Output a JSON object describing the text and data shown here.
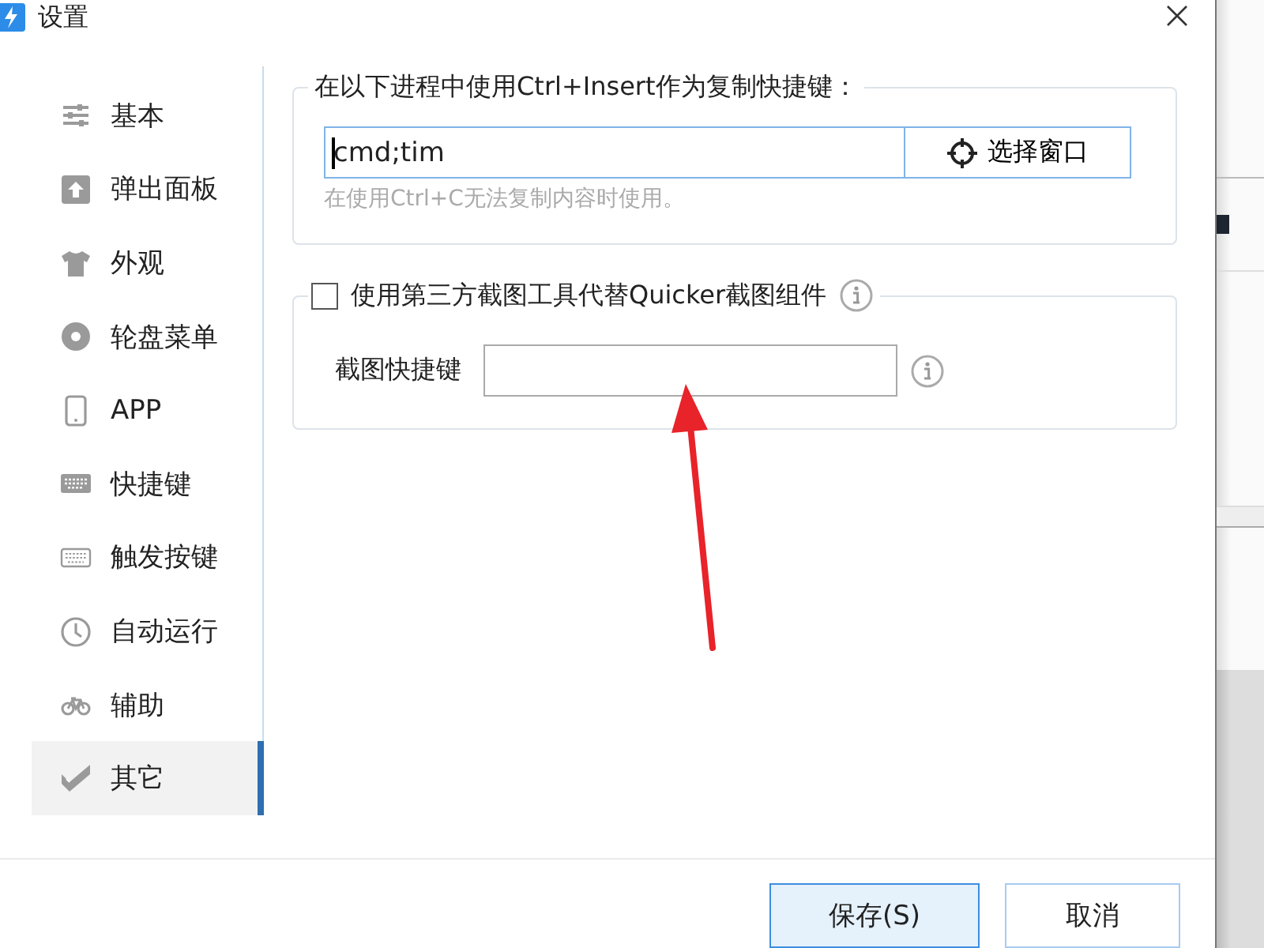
{
  "window": {
    "title": "设置"
  },
  "sidebar": {
    "items": [
      {
        "label": "基本",
        "selected": false
      },
      {
        "label": "弹出面板",
        "selected": false
      },
      {
        "label": "外观",
        "selected": false
      },
      {
        "label": "轮盘菜单",
        "selected": false
      },
      {
        "label": "APP",
        "selected": false
      },
      {
        "label": "快捷键",
        "selected": false
      },
      {
        "label": "触发按键",
        "selected": false
      },
      {
        "label": "自动运行",
        "selected": false
      },
      {
        "label": "辅助",
        "selected": false
      },
      {
        "label": "其它",
        "selected": true
      }
    ]
  },
  "copy_group": {
    "legend": "在以下进程中使用Ctrl+Insert作为复制快捷键：",
    "value": "cmd;tim",
    "pick_button": "选择窗口",
    "hint": "在使用Ctrl+C无法复制内容时使用。"
  },
  "screenshot_group": {
    "legend": "使用第三方截图工具代替Quicker截图组件",
    "checked": false,
    "shortcut_label": "截图快捷键"
  },
  "buttons": [
    {
      "label": "保存(S)",
      "kind": "primary"
    },
    {
      "label": "取消",
      "kind": "normal"
    }
  ]
}
